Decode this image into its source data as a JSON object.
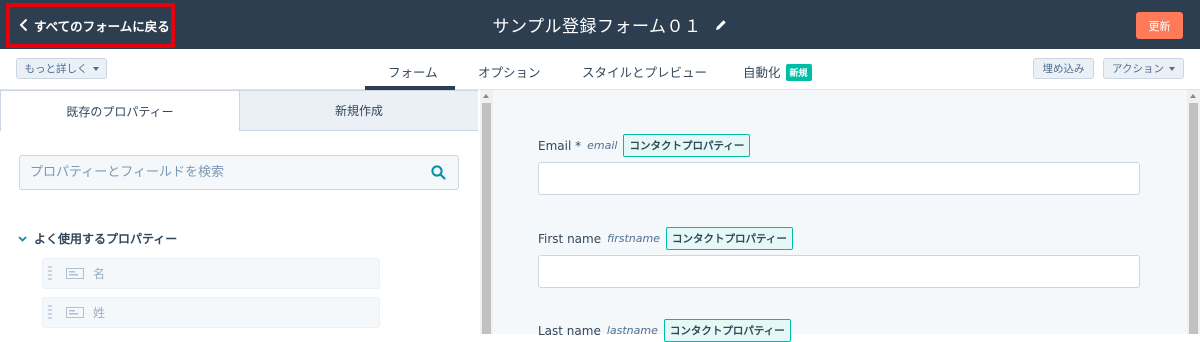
{
  "header": {
    "back_label": "すべてのフォームに戻る",
    "form_title": "サンプル登録フォーム０１",
    "update_label": "更新",
    "bg_color": "#2d3e50",
    "highlight_color": "#e8000b"
  },
  "subnav": {
    "details_label": "もっと詳しく",
    "tabs": [
      {
        "label": "フォーム",
        "active": true
      },
      {
        "label": "オプション"
      },
      {
        "label": "スタイルとプレビュー"
      },
      {
        "label": "自動化",
        "badge": "新規"
      }
    ],
    "embed_label": "埋め込み",
    "actions_label": "アクション"
  },
  "left_panel": {
    "tabs": [
      {
        "label": "既存のプロパティー",
        "active": true
      },
      {
        "label": "新規作成"
      }
    ],
    "search_placeholder": "プロパティーとフィールドを検索",
    "section_title": "よく使用するプロパティー",
    "items": [
      {
        "label": "名"
      },
      {
        "label": "姓"
      }
    ]
  },
  "form_fields": [
    {
      "label": "Email *",
      "internal": "email",
      "tag": "コンタクトプロパティー"
    },
    {
      "label": "First name",
      "internal": "firstname",
      "tag": "コンタクトプロパティー"
    },
    {
      "label": "Last name",
      "internal": "lastname",
      "tag": "コンタクトプロパティー"
    }
  ],
  "colors": {
    "accent_orange": "#ff7a59",
    "teal": "#00bda5"
  }
}
